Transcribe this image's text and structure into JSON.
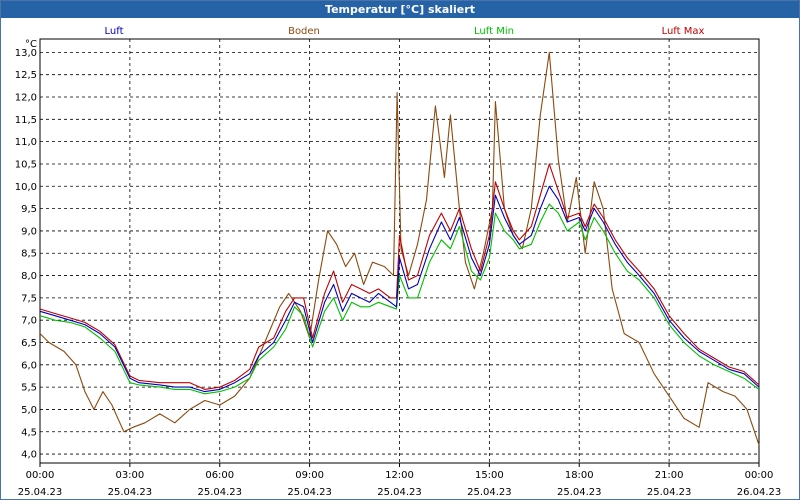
{
  "window": {
    "title": "Temperatur [°C] skaliert"
  },
  "chart_data": {
    "type": "line",
    "title": "Temperatur [°C] skaliert",
    "ylabel": "°C",
    "ylim": [
      3.8,
      13.3
    ],
    "yticks": [
      4.0,
      4.5,
      5.0,
      5.5,
      6.0,
      6.5,
      7.0,
      7.5,
      8.0,
      8.5,
      9.0,
      9.5,
      10.0,
      10.5,
      11.0,
      11.5,
      12.0,
      12.5,
      13.0
    ],
    "ytick_labels": [
      "4,0",
      "4,5",
      "5,0",
      "5,5",
      "6,0",
      "6,5",
      "7,0",
      "7,5",
      "8,0",
      "8,5",
      "9,0",
      "9,5",
      "10,0",
      "10,5",
      "11,0",
      "11,5",
      "12,0",
      "12,5",
      "13,0"
    ],
    "xlim": [
      0,
      24
    ],
    "xtick_time": [
      "00:00",
      "03:00",
      "06:00",
      "09:00",
      "12:00",
      "15:00",
      "18:00",
      "21:00",
      "00:00"
    ],
    "xtick_date": [
      "25.04.23",
      "25.04.23",
      "25.04.23",
      "25.04.23",
      "25.04.23",
      "25.04.23",
      "25.04.23",
      "25.04.23",
      "26.04.23"
    ],
    "grid": true,
    "legend_position": "top",
    "series": [
      {
        "name": "Luft",
        "color": "#0000c0",
        "points": [
          [
            0,
            7.2
          ],
          [
            0.5,
            7.1
          ],
          [
            1,
            7.0
          ],
          [
            1.5,
            6.9
          ],
          [
            2,
            6.7
          ],
          [
            2.5,
            6.4
          ],
          [
            3,
            5.7
          ],
          [
            3.3,
            5.6
          ],
          [
            4,
            5.55
          ],
          [
            4.5,
            5.5
          ],
          [
            5,
            5.5
          ],
          [
            5.5,
            5.4
          ],
          [
            6,
            5.45
          ],
          [
            6.5,
            5.6
          ],
          [
            7,
            5.8
          ],
          [
            7.3,
            6.2
          ],
          [
            7.8,
            6.5
          ],
          [
            8.2,
            7.0
          ],
          [
            8.5,
            7.4
          ],
          [
            8.8,
            7.3
          ],
          [
            9.1,
            6.5
          ],
          [
            9.5,
            7.4
          ],
          [
            9.8,
            7.8
          ],
          [
            10.1,
            7.2
          ],
          [
            10.4,
            7.6
          ],
          [
            10.7,
            7.5
          ],
          [
            11,
            7.4
          ],
          [
            11.3,
            7.6
          ],
          [
            11.7,
            7.4
          ],
          [
            11.9,
            7.3
          ],
          [
            12.0,
            8.4
          ],
          [
            12.3,
            7.7
          ],
          [
            12.6,
            7.8
          ],
          [
            13,
            8.6
          ],
          [
            13.4,
            9.2
          ],
          [
            13.7,
            8.8
          ],
          [
            14,
            9.3
          ],
          [
            14.4,
            8.4
          ],
          [
            14.7,
            8.0
          ],
          [
            15,
            8.7
          ],
          [
            15.2,
            9.8
          ],
          [
            15.5,
            9.3
          ],
          [
            15.8,
            8.9
          ],
          [
            16,
            8.7
          ],
          [
            16.4,
            8.9
          ],
          [
            16.7,
            9.5
          ],
          [
            17,
            10.0
          ],
          [
            17.3,
            9.7
          ],
          [
            17.6,
            9.2
          ],
          [
            18,
            9.3
          ],
          [
            18.2,
            9.0
          ],
          [
            18.5,
            9.5
          ],
          [
            18.8,
            9.2
          ],
          [
            19.2,
            8.7
          ],
          [
            19.6,
            8.3
          ],
          [
            20,
            8.0
          ],
          [
            20.5,
            7.6
          ],
          [
            21,
            7.0
          ],
          [
            21.5,
            6.6
          ],
          [
            22,
            6.3
          ],
          [
            22.5,
            6.1
          ],
          [
            23,
            5.9
          ],
          [
            23.5,
            5.8
          ],
          [
            24,
            5.5
          ]
        ]
      },
      {
        "name": "Boden",
        "color": "#8b4a0f",
        "points": [
          [
            0,
            6.7
          ],
          [
            0.3,
            6.5
          ],
          [
            0.8,
            6.3
          ],
          [
            1.2,
            6.0
          ],
          [
            1.5,
            5.4
          ],
          [
            1.8,
            5.0
          ],
          [
            2.1,
            5.4
          ],
          [
            2.4,
            5.1
          ],
          [
            2.8,
            4.5
          ],
          [
            3.1,
            4.6
          ],
          [
            3.5,
            4.7
          ],
          [
            4,
            4.9
          ],
          [
            4.5,
            4.7
          ],
          [
            5,
            5.0
          ],
          [
            5.5,
            5.2
          ],
          [
            6,
            5.1
          ],
          [
            6.5,
            5.3
          ],
          [
            7,
            5.7
          ],
          [
            7.5,
            6.5
          ],
          [
            8,
            7.3
          ],
          [
            8.3,
            7.6
          ],
          [
            8.7,
            7.2
          ],
          [
            9.0,
            6.6
          ],
          [
            9.3,
            7.9
          ],
          [
            9.6,
            9.0
          ],
          [
            9.9,
            8.7
          ],
          [
            10.2,
            8.2
          ],
          [
            10.5,
            8.5
          ],
          [
            10.8,
            7.8
          ],
          [
            11.1,
            8.3
          ],
          [
            11.5,
            8.2
          ],
          [
            11.8,
            8.0
          ],
          [
            11.92,
            12.1
          ],
          [
            12.05,
            8.6
          ],
          [
            12.3,
            8.0
          ],
          [
            12.6,
            8.7
          ],
          [
            12.9,
            9.7
          ],
          [
            13.2,
            11.8
          ],
          [
            13.5,
            10.2
          ],
          [
            13.7,
            11.6
          ],
          [
            14,
            9.5
          ],
          [
            14.2,
            8.3
          ],
          [
            14.5,
            7.7
          ],
          [
            14.8,
            8.5
          ],
          [
            15.1,
            9.5
          ],
          [
            15.2,
            11.9
          ],
          [
            15.5,
            9.5
          ],
          [
            15.8,
            8.9
          ],
          [
            16.1,
            8.6
          ],
          [
            16.4,
            9.5
          ],
          [
            16.7,
            11.6
          ],
          [
            17,
            13.0
          ],
          [
            17.3,
            10.6
          ],
          [
            17.6,
            9.2
          ],
          [
            17.9,
            10.2
          ],
          [
            18.2,
            8.5
          ],
          [
            18.5,
            10.1
          ],
          [
            18.8,
            9.5
          ],
          [
            19.1,
            7.7
          ],
          [
            19.5,
            6.7
          ],
          [
            20,
            6.5
          ],
          [
            20.5,
            5.8
          ],
          [
            21,
            5.3
          ],
          [
            21.5,
            4.8
          ],
          [
            22,
            4.6
          ],
          [
            22.3,
            5.6
          ],
          [
            22.8,
            5.4
          ],
          [
            23.2,
            5.3
          ],
          [
            23.6,
            5.0
          ],
          [
            24,
            4.2
          ]
        ]
      },
      {
        "name": "Luft Min",
        "color": "#00c000",
        "points": [
          [
            0,
            7.1
          ],
          [
            0.5,
            7.0
          ],
          [
            1,
            6.95
          ],
          [
            1.5,
            6.85
          ],
          [
            2,
            6.6
          ],
          [
            2.5,
            6.3
          ],
          [
            3,
            5.6
          ],
          [
            3.3,
            5.55
          ],
          [
            4,
            5.5
          ],
          [
            4.5,
            5.45
          ],
          [
            5,
            5.45
          ],
          [
            5.5,
            5.35
          ],
          [
            6,
            5.4
          ],
          [
            6.5,
            5.5
          ],
          [
            7,
            5.7
          ],
          [
            7.3,
            6.1
          ],
          [
            7.8,
            6.4
          ],
          [
            8.2,
            6.8
          ],
          [
            8.5,
            7.3
          ],
          [
            8.8,
            7.1
          ],
          [
            9.1,
            6.4
          ],
          [
            9.5,
            7.2
          ],
          [
            9.8,
            7.5
          ],
          [
            10.1,
            7.0
          ],
          [
            10.4,
            7.4
          ],
          [
            10.7,
            7.3
          ],
          [
            11,
            7.3
          ],
          [
            11.3,
            7.4
          ],
          [
            11.7,
            7.3
          ],
          [
            11.9,
            7.25
          ],
          [
            12.0,
            8.0
          ],
          [
            12.3,
            7.5
          ],
          [
            12.6,
            7.5
          ],
          [
            13,
            8.3
          ],
          [
            13.4,
            8.8
          ],
          [
            13.7,
            8.6
          ],
          [
            14,
            9.1
          ],
          [
            14.4,
            8.1
          ],
          [
            14.7,
            7.9
          ],
          [
            15,
            8.4
          ],
          [
            15.2,
            9.4
          ],
          [
            15.5,
            9.0
          ],
          [
            15.8,
            8.8
          ],
          [
            16,
            8.6
          ],
          [
            16.4,
            8.7
          ],
          [
            16.7,
            9.2
          ],
          [
            17,
            9.6
          ],
          [
            17.3,
            9.4
          ],
          [
            17.6,
            9.0
          ],
          [
            18,
            9.2
          ],
          [
            18.2,
            8.8
          ],
          [
            18.5,
            9.3
          ],
          [
            18.8,
            9.0
          ],
          [
            19.2,
            8.5
          ],
          [
            19.6,
            8.1
          ],
          [
            20,
            7.9
          ],
          [
            20.5,
            7.5
          ],
          [
            21,
            6.9
          ],
          [
            21.5,
            6.5
          ],
          [
            22,
            6.2
          ],
          [
            22.5,
            6.0
          ],
          [
            23,
            5.85
          ],
          [
            23.5,
            5.7
          ],
          [
            24,
            5.45
          ]
        ]
      },
      {
        "name": "Luft Max",
        "color": "#c00000",
        "points": [
          [
            0,
            7.25
          ],
          [
            0.5,
            7.15
          ],
          [
            1,
            7.05
          ],
          [
            1.5,
            6.95
          ],
          [
            2,
            6.75
          ],
          [
            2.5,
            6.45
          ],
          [
            3,
            5.75
          ],
          [
            3.3,
            5.65
          ],
          [
            4,
            5.6
          ],
          [
            4.5,
            5.6
          ],
          [
            5,
            5.6
          ],
          [
            5.5,
            5.45
          ],
          [
            6,
            5.5
          ],
          [
            6.5,
            5.65
          ],
          [
            7,
            5.9
          ],
          [
            7.3,
            6.4
          ],
          [
            7.8,
            6.6
          ],
          [
            8.2,
            7.2
          ],
          [
            8.5,
            7.5
          ],
          [
            8.8,
            7.5
          ],
          [
            9.1,
            6.6
          ],
          [
            9.5,
            7.6
          ],
          [
            9.8,
            8.1
          ],
          [
            10.1,
            7.4
          ],
          [
            10.4,
            7.8
          ],
          [
            10.7,
            7.7
          ],
          [
            11,
            7.6
          ],
          [
            11.3,
            7.7
          ],
          [
            11.7,
            7.5
          ],
          [
            11.9,
            7.5
          ],
          [
            12.0,
            8.9
          ],
          [
            12.3,
            7.9
          ],
          [
            12.6,
            8.0
          ],
          [
            13,
            8.9
          ],
          [
            13.4,
            9.4
          ],
          [
            13.7,
            9.0
          ],
          [
            14,
            9.5
          ],
          [
            14.4,
            8.6
          ],
          [
            14.7,
            8.1
          ],
          [
            15,
            8.9
          ],
          [
            15.2,
            10.1
          ],
          [
            15.5,
            9.5
          ],
          [
            15.8,
            9.0
          ],
          [
            16,
            8.8
          ],
          [
            16.4,
            9.1
          ],
          [
            16.7,
            9.8
          ],
          [
            17,
            10.5
          ],
          [
            17.3,
            9.9
          ],
          [
            17.6,
            9.3
          ],
          [
            18,
            9.4
          ],
          [
            18.2,
            9.1
          ],
          [
            18.5,
            9.6
          ],
          [
            18.8,
            9.3
          ],
          [
            19.2,
            8.8
          ],
          [
            19.6,
            8.4
          ],
          [
            20,
            8.1
          ],
          [
            20.5,
            7.7
          ],
          [
            21,
            7.1
          ],
          [
            21.5,
            6.7
          ],
          [
            22,
            6.35
          ],
          [
            22.5,
            6.15
          ],
          [
            23,
            5.95
          ],
          [
            23.5,
            5.85
          ],
          [
            24,
            5.55
          ]
        ]
      }
    ]
  }
}
